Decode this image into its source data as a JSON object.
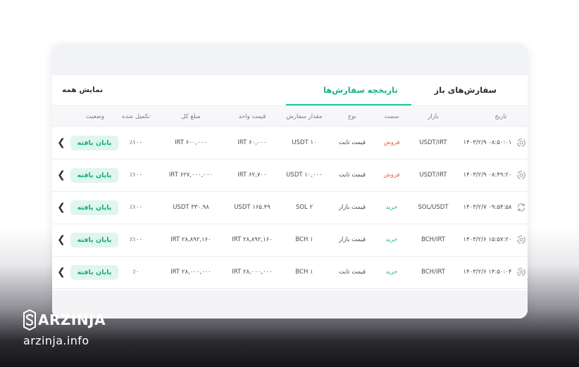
{
  "tabs": {
    "show_all": "نمایش همه",
    "history": "تاریخچه سفارش‌ها",
    "open_orders": "سفارش‌های باز"
  },
  "columns": {
    "date": "تاریخ",
    "market": "بازار",
    "side": "سمت",
    "type": "نوع",
    "amount": "مقدار سفارش",
    "unit_price": "قیمت واحد",
    "total": "مبلغ کل",
    "filled": "تکمیل شده",
    "status": "وضعیت"
  },
  "rows": [
    {
      "date": "۱۴۰۳/۲/۹ ۰۸:۵۰:۰۱",
      "market": "USDT/IRT",
      "side": "فروش",
      "side_color": "#e85a4f",
      "type": "قیمت ثابت",
      "amount": "USDT ۱۰",
      "unit_price": "IRT ۶۰,۰۰۰",
      "total": "IRT ۶۰۰,۰۰۰",
      "filled": "٪۱۰۰",
      "status": "پایان یافته",
      "icon": "sync-circle-icon"
    },
    {
      "date": "۱۴۰۳/۲/۹ ۰۸:۴۹:۲۰",
      "market": "USDT/IRT",
      "side": "فروش",
      "side_color": "#e85a4f",
      "type": "قیمت ثابت",
      "amount": "USDT ۱۰,۰۰۰",
      "unit_price": "IRT ۶۲,۷۰۰",
      "total": "IRT ۶۲۷,۰۰۰,۰۰۰",
      "filled": "٪۱۰۰",
      "status": "پایان یافته",
      "icon": "sync-circle-icon"
    },
    {
      "date": "۱۴۰۳/۲/۷ ۰۹:۵۴:۵۸",
      "market": "SOL/USDT",
      "side": "خرید",
      "side_color": "#2eb872",
      "type": "قیمت بازار",
      "amount": "SOL ۲",
      "unit_price": "USDT ۱۶۵.۴۹",
      "total": "USDT ۳۳۰.۹۸",
      "filled": "٪۱۰۰",
      "status": "پایان یافته",
      "icon": "swap-arrows-icon"
    },
    {
      "date": "۱۴۰۳/۲/۶ ۱۵:۵۷:۲۰",
      "market": "BCH/IRT",
      "side": "خرید",
      "side_color": "#2eb872",
      "type": "قیمت بازار",
      "amount": "BCH ۱",
      "unit_price": "IRT ۲۸,۸۹۲,۱۶۰",
      "total": "IRT ۲۸,۸۹۲,۱۶۰",
      "filled": "٪۱۰۰",
      "status": "پایان یافته",
      "icon": "sync-circle-icon"
    },
    {
      "date": "۱۴۰۳/۲/۶ ۱۴:۵۰:۰۴",
      "market": "BCH/IRT",
      "side": "خرید",
      "side_color": "#2eb872",
      "type": "قیمت ثابت",
      "amount": "BCH ۱",
      "unit_price": "IRT ۲۸,۰۰۰,۰۰۰",
      "total": "IRT ۲۸,۰۰۰,۰۰۰",
      "filled": "٪۰",
      "status": "پایان یافته",
      "icon": "sync-circle-icon"
    }
  ],
  "brand": {
    "name": "ARZINJA",
    "url": "arzinja.info"
  },
  "colors": {
    "accent": "#1fc796",
    "badge_bg": "#dff6ee",
    "badge_text": "#18a97f",
    "sell": "#e85a4f",
    "buy": "#2eb872"
  }
}
